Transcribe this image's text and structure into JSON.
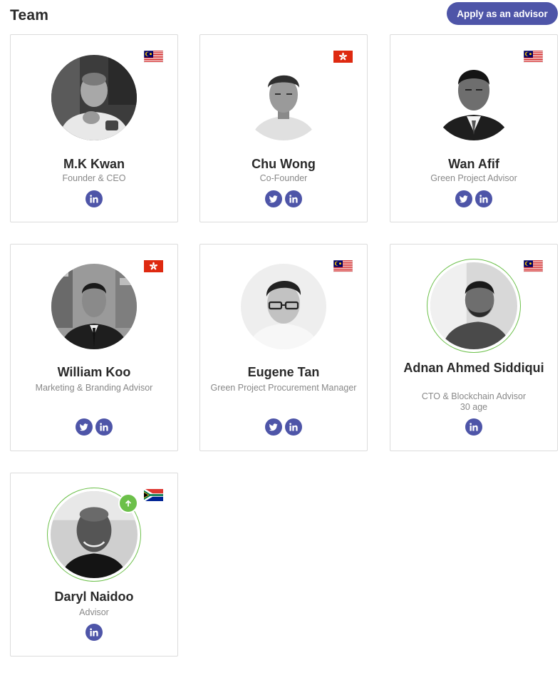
{
  "header": {
    "title": "Team",
    "apply_label": "Apply as an advisor"
  },
  "members": [
    {
      "name": "M.K Kwan",
      "role": "Founder & CEO",
      "flag": "malaysia-flag-icon",
      "socials": [
        "linkedin-icon"
      ]
    },
    {
      "name": "Chu Wong",
      "role": "Co-Founder",
      "flag": "hong-kong-flag-icon",
      "socials": [
        "twitter-icon",
        "linkedin-icon"
      ]
    },
    {
      "name": "Wan Afif",
      "role": "Green Project Advisor",
      "flag": "malaysia-flag-icon",
      "socials": [
        "twitter-icon",
        "linkedin-icon"
      ]
    },
    {
      "name": "William Koo",
      "role": "Marketing & Branding Advisor",
      "flag": "hong-kong-flag-icon",
      "socials": [
        "twitter-icon",
        "linkedin-icon"
      ]
    },
    {
      "name": "Eugene Tan",
      "role": "Green Project Procurement Manager",
      "flag": "malaysia-flag-icon",
      "socials": [
        "twitter-icon",
        "linkedin-icon"
      ]
    },
    {
      "name": "Adnan Ahmed Siddiqui",
      "role": "CTO & Blockchain Advisor",
      "age": "30 age",
      "flag": "malaysia-flag-icon",
      "socials": [
        "linkedin-icon"
      ]
    },
    {
      "name": "Daryl Naidoo",
      "role": "Advisor",
      "flag": "south-africa-flag-icon",
      "socials": [
        "linkedin-icon"
      ],
      "badge": "arrow-up-icon"
    }
  ],
  "colors": {
    "accent": "#4e55a8",
    "ring": "#6cc04a",
    "muted_text": "#888888",
    "title_text": "#2a2a2a"
  }
}
